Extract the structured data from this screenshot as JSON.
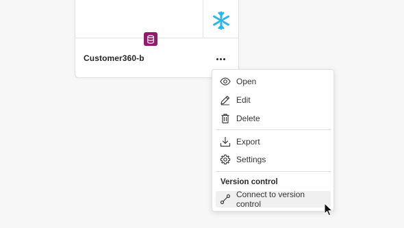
{
  "card": {
    "title": "Customer360-b",
    "source_icon": "snowflake-icon",
    "badge_icon": "database-icon",
    "badge_color": "#8f1d6e",
    "snowflake_color": "#29b5e8",
    "more_icon": "more-horizontal-icon"
  },
  "menu": {
    "items": [
      {
        "label": "Open",
        "icon": "eye-icon"
      },
      {
        "label": "Edit",
        "icon": "pencil-icon"
      },
      {
        "label": "Delete",
        "icon": "trash-icon"
      },
      {
        "label": "Export",
        "icon": "download-icon"
      },
      {
        "label": "Settings",
        "icon": "gear-icon"
      }
    ],
    "version_control_heading": "Version control",
    "version_control_item": {
      "label": "Connect to version control",
      "icon": "git-connect-icon"
    }
  }
}
